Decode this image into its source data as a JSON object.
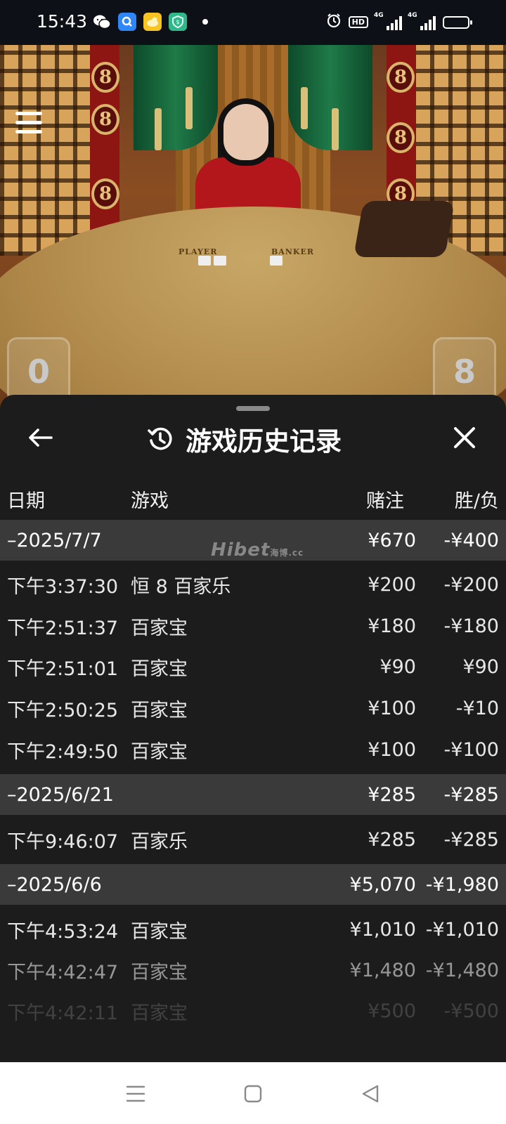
{
  "status_bar": {
    "time": "15:43",
    "notification_icons": [
      "wechat-icon",
      "search-app-icon",
      "duck-app-icon",
      "shield-app-icon"
    ],
    "system_icons": [
      "alarm-icon",
      "hd-icon",
      "signal-4g-icon",
      "signal-4g-icon",
      "battery-icon"
    ],
    "hd_label": "HD",
    "network_label_1": "4G",
    "network_label_2": "4G",
    "battery_level": 0.6
  },
  "game_scene": {
    "player_label": "PLAYER",
    "banker_label": "BANKER",
    "player_score": "0",
    "banker_score": "8"
  },
  "sheet": {
    "title": "游戏历史记录",
    "columns": {
      "date": "日期",
      "game": "游戏",
      "bet": "赌注",
      "win_loss": "胜/负"
    },
    "watermark": "Hibet",
    "watermark_small": "海博.cc",
    "groups": [
      {
        "date": "–2025/7/7",
        "bet": "¥670",
        "win_loss": "-¥400",
        "rows": [
          {
            "time": "下午3:37:30",
            "game": "恒 8 百家乐",
            "bet": "¥200",
            "win_loss": "-¥200"
          },
          {
            "time": "下午2:51:37",
            "game": "百家宝",
            "bet": "¥180",
            "win_loss": "-¥180"
          },
          {
            "time": "下午2:51:01",
            "game": "百家宝",
            "bet": "¥90",
            "win_loss": "¥90"
          },
          {
            "time": "下午2:50:25",
            "game": "百家宝",
            "bet": "¥100",
            "win_loss": "-¥10"
          },
          {
            "time": "下午2:49:50",
            "game": "百家宝",
            "bet": "¥100",
            "win_loss": "-¥100"
          }
        ]
      },
      {
        "date": "–2025/6/21",
        "bet": "¥285",
        "win_loss": "-¥285",
        "rows": [
          {
            "time": "下午9:46:07",
            "game": "百家乐",
            "bet": "¥285",
            "win_loss": "-¥285"
          }
        ]
      },
      {
        "date": "–2025/6/6",
        "bet": "¥5,070",
        "win_loss": "-¥1,980",
        "rows": [
          {
            "time": "下午4:53:24",
            "game": "百家宝",
            "bet": "¥1,010",
            "win_loss": "-¥1,010"
          },
          {
            "time": "下午4:42:47",
            "game": "百家宝",
            "bet": "¥1,480",
            "win_loss": "-¥1,480"
          },
          {
            "time": "下午4:42:11",
            "game": "百家宝",
            "bet": "¥500",
            "win_loss": "-¥500"
          }
        ]
      }
    ]
  },
  "nav_bar": {
    "buttons": [
      "menu-icon",
      "home-square-icon",
      "back-triangle-icon"
    ]
  }
}
